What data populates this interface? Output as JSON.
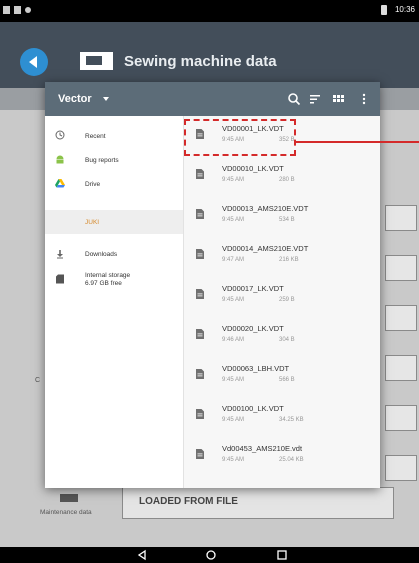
{
  "status_bar": {
    "time": "10:36"
  },
  "app_bar": {
    "title": "Sewing machine data"
  },
  "background": {
    "loaded_button": "LOADED FROM FILE",
    "maintenance_label": "Maintenance data"
  },
  "dialog": {
    "title": "Vector",
    "drawer": {
      "items": [
        {
          "label": "Recent",
          "icon": "clock-icon"
        },
        {
          "label": "Bug reports",
          "icon": "android-icon"
        },
        {
          "label": "Drive",
          "icon": "drive-icon"
        },
        {
          "label": "JUKI",
          "icon": "usb-icon",
          "selected": true
        },
        {
          "label": "Downloads",
          "icon": "download-icon"
        },
        {
          "label": "Internal storage",
          "sub": "6.97 GB free",
          "icon": "sd-card-icon"
        }
      ]
    },
    "files": [
      {
        "name": "VD00001_LK.VDT",
        "time": "9:45 AM",
        "size": "352 B"
      },
      {
        "name": "VD00010_LK.VDT",
        "time": "9:45 AM",
        "size": "280 B"
      },
      {
        "name": "VD00013_AMS210E.VDT",
        "time": "9:45 AM",
        "size": "534 B"
      },
      {
        "name": "VD00014_AMS210E.VDT",
        "time": "9:47 AM",
        "size": "216 KB"
      },
      {
        "name": "VD00017_LK.VDT",
        "time": "9:45 AM",
        "size": "259 B"
      },
      {
        "name": "VD00020_LK.VDT",
        "time": "9:46 AM",
        "size": "304 B"
      },
      {
        "name": "VD00063_LBH.VDT",
        "time": "9:45 AM",
        "size": "566 B"
      },
      {
        "name": "VD00100_LK.VDT",
        "time": "9:45 AM",
        "size": "34.25 KB"
      },
      {
        "name": "Vd00453_AMS210E.vdt",
        "time": "9:45 AM",
        "size": "25.04 KB"
      }
    ]
  },
  "colors": {
    "app_bar": "#434e5a",
    "dialog_toolbar": "#5c6c78",
    "accent_blue": "#2e8fd2",
    "highlight_red": "#d42a2a",
    "selected_text": "#d58a2c"
  }
}
